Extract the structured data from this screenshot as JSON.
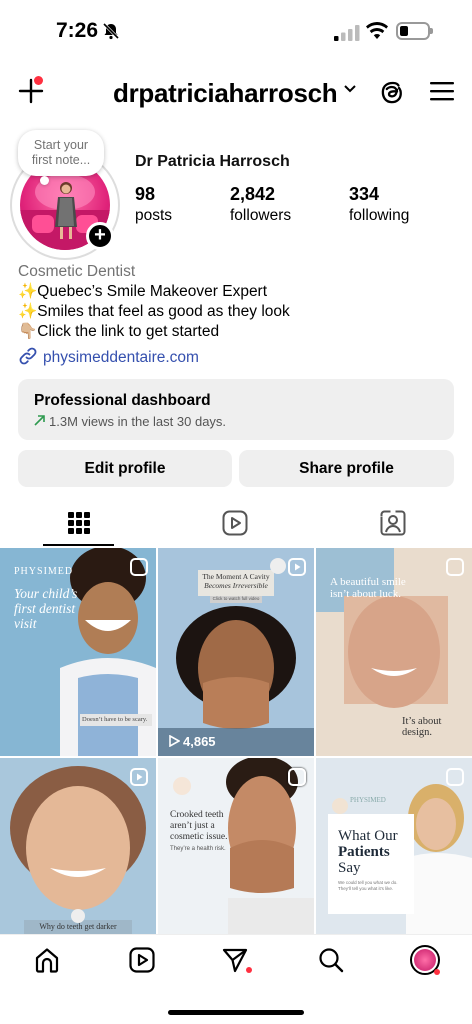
{
  "status": {
    "time": "7:26"
  },
  "header": {
    "username": "drpatriciaharrosch"
  },
  "note": {
    "line1": "Start your",
    "line2": "first note..."
  },
  "profile": {
    "name": "Dr Patricia Harrosch",
    "posts": "98",
    "posts_label": "posts",
    "followers": "2,842",
    "followers_label": "followers",
    "following": "334",
    "following_label": "following"
  },
  "bio": {
    "category": "Cosmetic Dentist",
    "line1": "✨Quebec’s Smile Makeover Expert",
    "line2": "✨Smiles that feel as good as they look",
    "line3": "👇🏼Click the link to get started",
    "link": "physimeddentaire.com"
  },
  "dashboard": {
    "title": "Professional dashboard",
    "subtitle": "1.3M views in the last 30 days."
  },
  "buttons": {
    "edit": "Edit profile",
    "share": "Share profile"
  },
  "posts": [
    {
      "brand": "PHYSIMED",
      "title1": "Your child’s",
      "title2": "first dentist",
      "title3": "visit",
      "caption": "Doesn’t have to be scary."
    },
    {
      "title1": "The Moment A Cavity",
      "title2": "Becomes Irreversible",
      "caption": "Click to watch full video",
      "views": "4,865"
    },
    {
      "title1": "A beautiful smile",
      "title2": "isn’t about luck.",
      "caption1": "It’s about",
      "caption2": "design."
    },
    {
      "caption": "Why do teeth get darker"
    },
    {
      "title1": "Crooked teeth",
      "title2": "aren’t just a",
      "title3": "cosmetic issue.",
      "caption": "They’re a health risk."
    },
    {
      "brand": "PHYSIMED",
      "title1": "What Our",
      "title2": "Patients",
      "title3": "Say",
      "caption": "We could tell you what we do. They’ll tell you what it’s like."
    }
  ],
  "colors": {
    "accent_link": "#3550ae",
    "notification": "#ff3040",
    "tile_blue": "#7fb0cf",
    "tile_beige": "#e9dccd"
  }
}
